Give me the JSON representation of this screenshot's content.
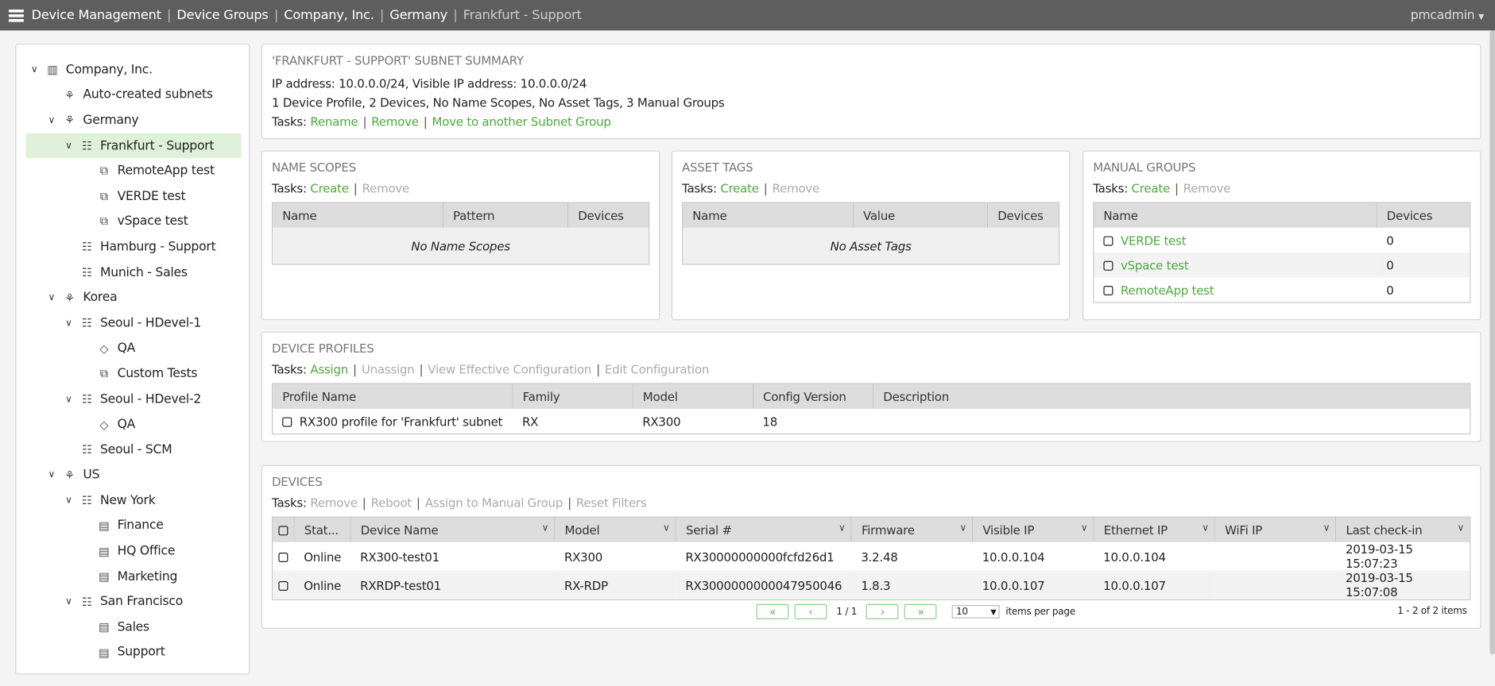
{
  "topbar": {
    "breadcrumbs": [
      "Device Management",
      "Device Groups",
      "Company, Inc.",
      "Germany"
    ],
    "current": "Frankfurt - Support",
    "user": "pmcadmin"
  },
  "tree": [
    {
      "label": "Company, Inc.",
      "level": 0,
      "icon": "building-icon",
      "expanded": true
    },
    {
      "label": "Auto-created subnets",
      "level": 1,
      "icon": "subnet-group-icon"
    },
    {
      "label": "Germany",
      "level": 1,
      "icon": "subnet-group-icon",
      "expanded": true
    },
    {
      "label": "Frankfurt - Support",
      "level": 2,
      "icon": "subnet-icon",
      "expanded": true,
      "selected": true
    },
    {
      "label": "RemoteApp test",
      "level": 3,
      "icon": "manual-group-icon"
    },
    {
      "label": "VERDE test",
      "level": 3,
      "icon": "manual-group-icon"
    },
    {
      "label": "vSpace test",
      "level": 3,
      "icon": "manual-group-icon"
    },
    {
      "label": "Hamburg - Support",
      "level": 2,
      "icon": "subnet-icon"
    },
    {
      "label": "Munich - Sales",
      "level": 2,
      "icon": "subnet-icon"
    },
    {
      "label": "Korea",
      "level": 1,
      "icon": "subnet-group-icon",
      "expanded": true
    },
    {
      "label": "Seoul - HDevel-1",
      "level": 2,
      "icon": "subnet-icon",
      "expanded": true
    },
    {
      "label": "QA",
      "level": 3,
      "icon": "tag-icon"
    },
    {
      "label": "Custom Tests",
      "level": 3,
      "icon": "manual-group-icon"
    },
    {
      "label": "Seoul - HDevel-2",
      "level": 2,
      "icon": "subnet-icon",
      "expanded": true
    },
    {
      "label": "QA",
      "level": 3,
      "icon": "tag-icon"
    },
    {
      "label": "Seoul - SCM",
      "level": 2,
      "icon": "subnet-icon"
    },
    {
      "label": "US",
      "level": 1,
      "icon": "subnet-group-icon",
      "expanded": true
    },
    {
      "label": "New York",
      "level": 2,
      "icon": "subnet-icon",
      "expanded": true
    },
    {
      "label": "Finance",
      "level": 3,
      "icon": "name-scope-icon"
    },
    {
      "label": "HQ Office",
      "level": 3,
      "icon": "name-scope-icon"
    },
    {
      "label": "Marketing",
      "level": 3,
      "icon": "name-scope-icon"
    },
    {
      "label": "San Francisco",
      "level": 2,
      "icon": "subnet-icon",
      "expanded": true
    },
    {
      "label": "Sales",
      "level": 3,
      "icon": "name-scope-icon"
    },
    {
      "label": "Support",
      "level": 3,
      "icon": "name-scope-icon"
    }
  ],
  "summary": {
    "title": "'FRANKFURT - SUPPORT' SUBNET SUMMARY",
    "ip_line": "IP address: 10.0.0.0/24, Visible IP address: 10.0.0.0/24",
    "counts_line": "1 Device Profile, 2 Devices, No Name Scopes, No Asset Tags, 3 Manual Groups",
    "tasks_label": "Tasks:",
    "tasks": [
      "Rename",
      "Remove",
      "Move to another Subnet Group"
    ]
  },
  "name_scopes": {
    "title": "NAME SCOPES",
    "tasks_label": "Tasks:",
    "create": "Create",
    "remove": "Remove",
    "columns": [
      "Name",
      "Pattern",
      "Devices"
    ],
    "empty": "No Name Scopes"
  },
  "asset_tags": {
    "title": "ASSET TAGS",
    "tasks_label": "Tasks:",
    "create": "Create",
    "remove": "Remove",
    "columns": [
      "Name",
      "Value",
      "Devices"
    ],
    "empty": "No Asset Tags"
  },
  "manual_groups": {
    "title": "MANUAL GROUPS",
    "tasks_label": "Tasks:",
    "create": "Create",
    "remove": "Remove",
    "columns": [
      "Name",
      "Devices"
    ],
    "rows": [
      {
        "name": "VERDE test",
        "devices": "0"
      },
      {
        "name": "vSpace test",
        "devices": "0"
      },
      {
        "name": "RemoteApp test",
        "devices": "0"
      }
    ]
  },
  "device_profiles": {
    "title": "DEVICE PROFILES",
    "tasks_label": "Tasks:",
    "assign": "Assign",
    "disabled_tasks": [
      "Unassign",
      "View Effective Configuration",
      "Edit Configuration"
    ],
    "columns": [
      "Profile Name",
      "Family",
      "Model",
      "Config Version",
      "Description"
    ],
    "rows": [
      {
        "profile": "RX300 profile for 'Frankfurt' subnet",
        "family": "RX",
        "model": "RX300",
        "version": "18",
        "description": ""
      }
    ]
  },
  "devices": {
    "title": "DEVICES",
    "tasks_label": "Tasks:",
    "disabled_tasks": [
      "Remove",
      "Reboot",
      "Assign to Manual Group",
      "Reset Filters"
    ],
    "columns": [
      "Stat...",
      "Device Name",
      "Model",
      "Serial #",
      "Firmware",
      "Visible IP",
      "Ethernet IP",
      "WiFi IP",
      "Last check-in"
    ],
    "rows": [
      {
        "status": "Online",
        "name": "RX300-test01",
        "model": "RX300",
        "serial": "RX30000000000fcfd26d1",
        "firmware": "3.2.48",
        "visible_ip": "10.0.0.104",
        "ethernet_ip": "10.0.0.104",
        "wifi_ip": "",
        "checkin": "2019-03-15 15:07:23"
      },
      {
        "status": "Online",
        "name": "RXRDP-test01",
        "model": "RX-RDP",
        "serial": "RX3000000000047950046",
        "firmware": "1.8.3",
        "visible_ip": "10.0.0.107",
        "ethernet_ip": "10.0.0.107",
        "wifi_ip": "",
        "checkin": "2019-03-15 15:07:08"
      }
    ],
    "pager": {
      "page": "1 / 1",
      "page_size": "10",
      "per_page_label": "items per page",
      "range": "1 - 2 of 2 items"
    }
  },
  "colors": {
    "topbar": "#5e5e5e",
    "link": "#4caa3c",
    "selected": "#dff0d8",
    "header": "#dcdcdc"
  }
}
